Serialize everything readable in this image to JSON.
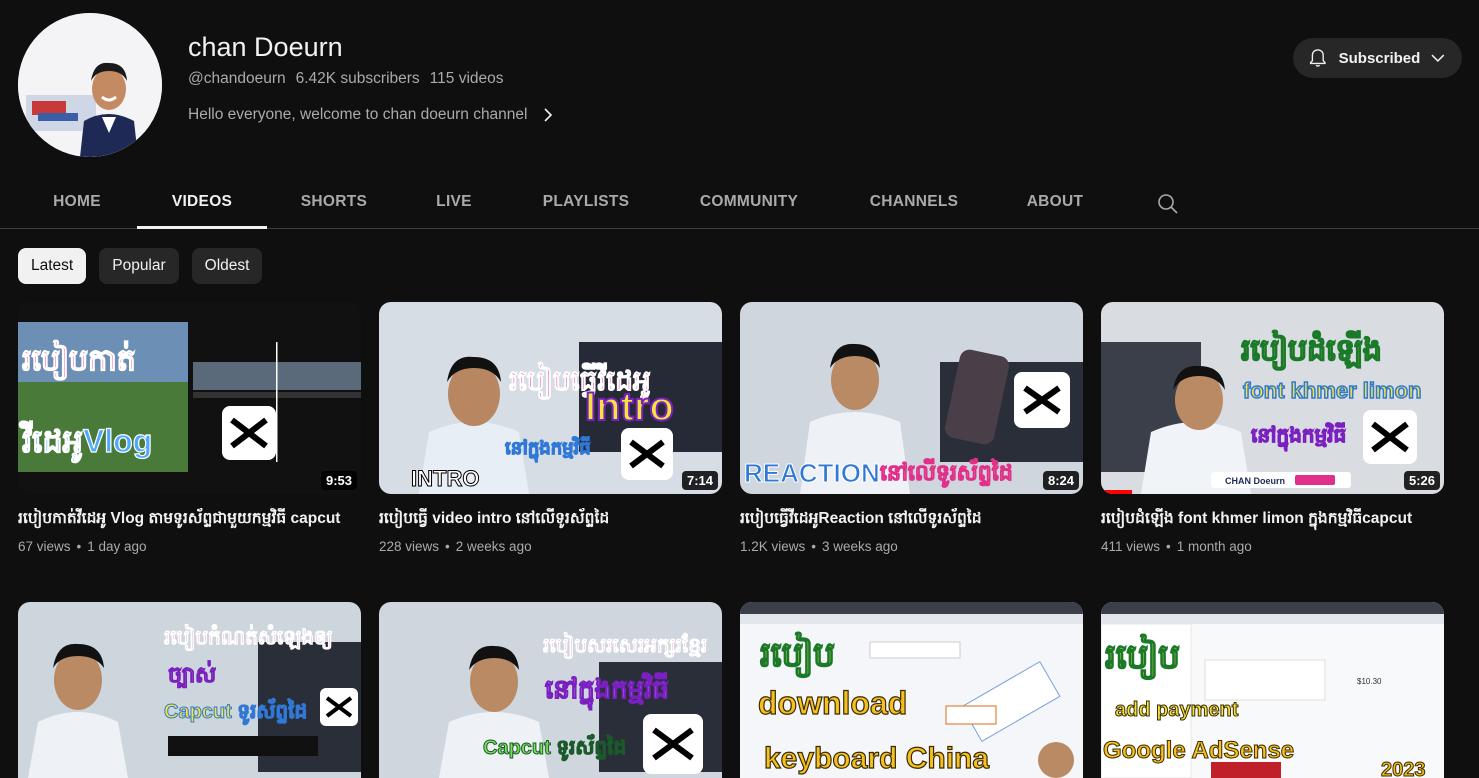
{
  "channel": {
    "name": "chan Doeurn",
    "handle": "@chandoeurn",
    "subscribers": "6.42K subscribers",
    "video_count": "115 videos",
    "description": "Hello everyone, welcome to chan doeurn channel",
    "subscribe_label": "Subscribed"
  },
  "tabs": [
    {
      "label": "HOME"
    },
    {
      "label": "VIDEOS"
    },
    {
      "label": "SHORTS"
    },
    {
      "label": "LIVE"
    },
    {
      "label": "PLAYLISTS"
    },
    {
      "label": "COMMUNITY"
    },
    {
      "label": "CHANNELS"
    },
    {
      "label": "ABOUT"
    }
  ],
  "active_tab": "VIDEOS",
  "chips": [
    {
      "label": "Latest",
      "selected": true
    },
    {
      "label": "Popular",
      "selected": false
    },
    {
      "label": "Oldest",
      "selected": false
    }
  ],
  "videos": [
    {
      "title": "របៀបកាត់វីដេអូ Vlog តាមទូរស័ព្ទជាមួយកម្មវិធី capcut",
      "views": "67 views",
      "age": "1 day ago",
      "duration": "9:53",
      "thumb_text": [
        "របៀបកាត់",
        "វីដេអូVlog"
      ]
    },
    {
      "title": "របៀបធ្វើ video intro នៅលើទូរស័ព្ទដៃ",
      "views": "228 views",
      "age": "2 weeks ago",
      "duration": "7:14",
      "thumb_text": [
        "របៀបធ្វើវីដេអូ",
        "Intro",
        "នៅក្នុងកម្មវិធី",
        "INTRO"
      ]
    },
    {
      "title": "របៀបធ្វើវីដេអូReaction នៅលើទូរស័ព្ទដៃ",
      "views": "1.2K views",
      "age": "3 weeks ago",
      "duration": "8:24",
      "thumb_text": [
        "REACTION",
        "នៅលើទូរស័ព្ទដៃ"
      ]
    },
    {
      "title": "របៀបដំឡើង font khmer limon ក្នុងកម្មវិធីcapcut",
      "views": "411 views",
      "age": "1 month ago",
      "duration": "5:26",
      "progress": 0.09,
      "thumb_text": [
        "របៀបដំឡើង",
        "font khmer limon",
        "នៅក្នុងកម្មវិធី",
        "CHAN Doeurn"
      ]
    },
    {
      "title": "",
      "views": "",
      "age": "",
      "duration": "",
      "thumb_text": [
        "របៀបកំណត់សំឡេងឲ្យ",
        "ច្បាស់",
        "Capcut ទូរស័ព្ទដៃ"
      ]
    },
    {
      "title": "",
      "views": "",
      "age": "",
      "duration": "",
      "thumb_text": [
        "របៀបសរសេរអក្សរខ្មែរ",
        "នៅក្នុងកម្មវិធី",
        "Capcut ទូរស័ព្ទដៃ"
      ]
    },
    {
      "title": "",
      "views": "",
      "age": "",
      "duration": "",
      "thumb_text": [
        "របៀប",
        "download",
        "keyboard China"
      ]
    },
    {
      "title": "",
      "views": "",
      "age": "",
      "duration": "",
      "thumb_text": [
        "របៀប",
        "add payment",
        "Google AdSense",
        "2023",
        "$10.30"
      ]
    }
  ],
  "colors": {
    "background": "#0f0f0f",
    "chip": "#272727",
    "text_secondary": "#aaaaaa",
    "capcut_badge": "#ffffff",
    "thumb_yellow": "#f5e53a",
    "thumb_magenta": "#e0308a",
    "thumb_purple": "#8a36d8",
    "thumb_blue": "#2f78d6",
    "thumb_green": "#1fa34a",
    "progress_red": "#ff0000"
  },
  "icons": [
    "bell-icon",
    "chevron-down-icon",
    "chevron-right-icon",
    "search-icon",
    "capcut-logo-icon"
  ]
}
